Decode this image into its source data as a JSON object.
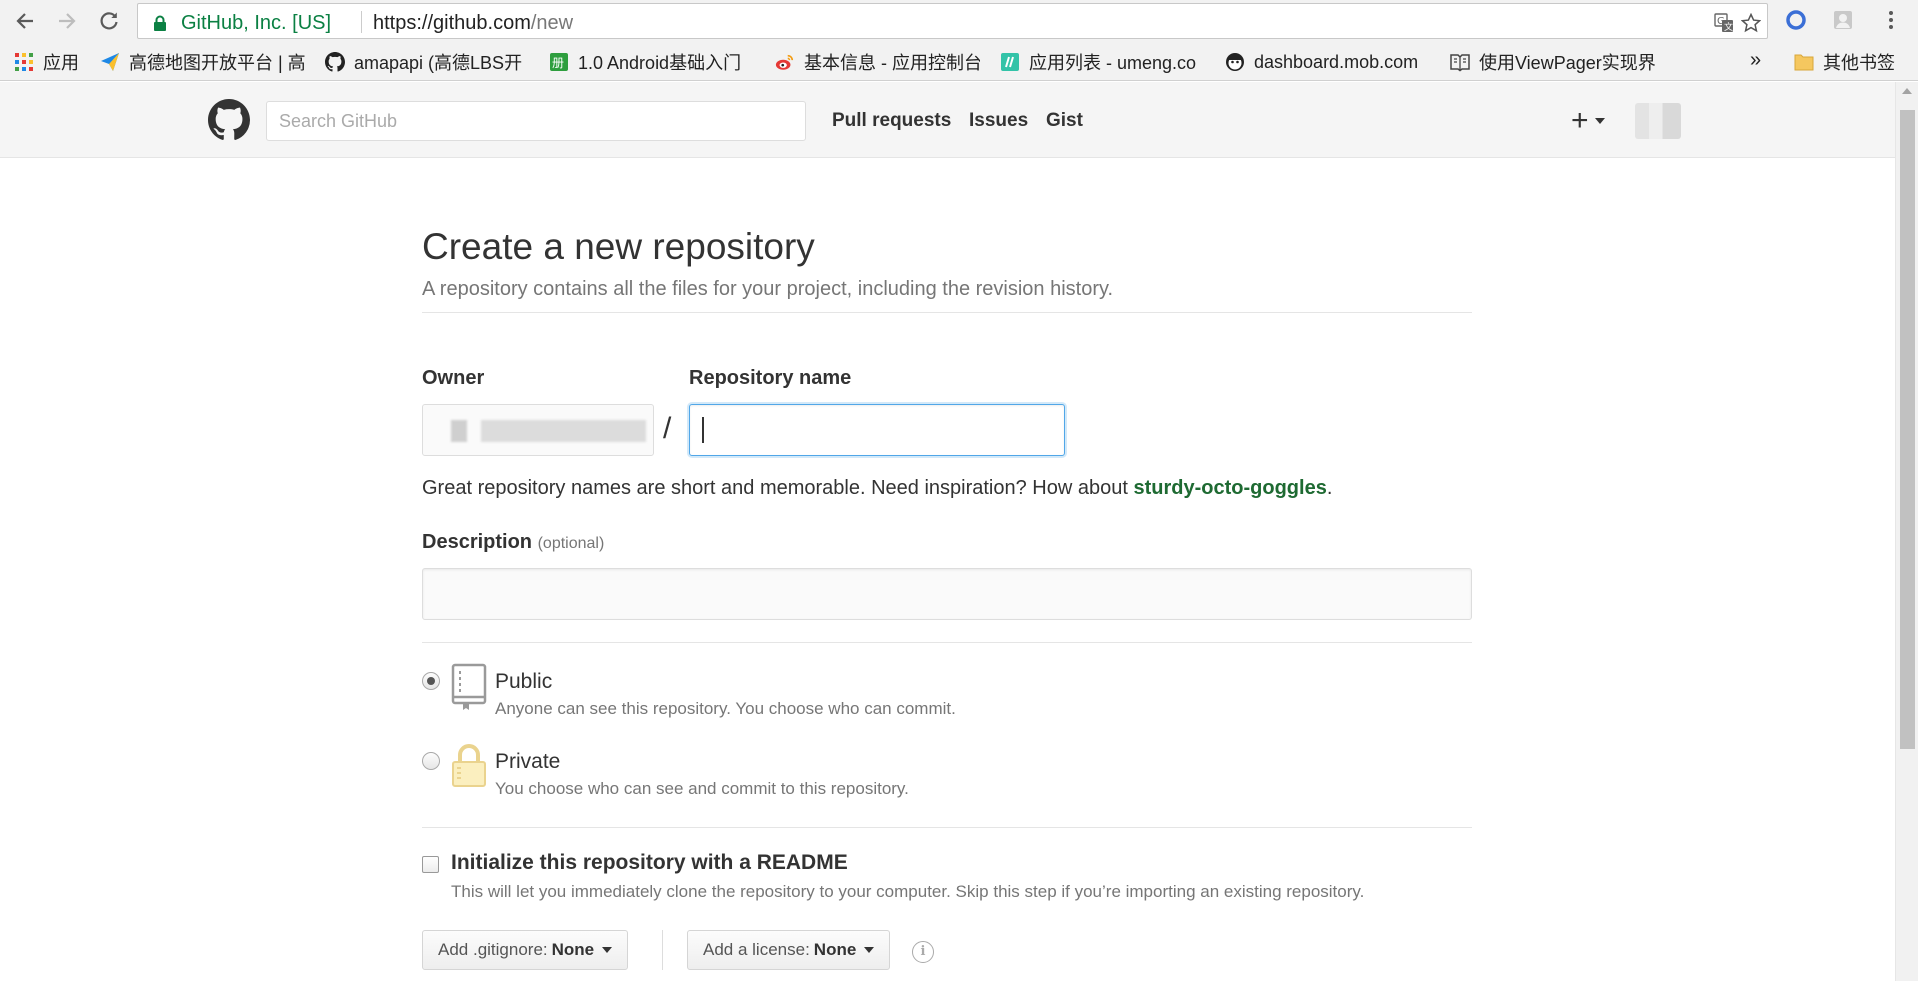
{
  "browser": {
    "omnibox": {
      "ev_label": "GitHub, Inc. [US]",
      "url_origin": "https://github.com",
      "url_path": "/new"
    },
    "bookmarks": [
      {
        "label": "应用",
        "icon": "apps-grid-icon"
      },
      {
        "label": "高德地图开放平台 | 高",
        "icon": "paper-plane-icon"
      },
      {
        "label": "amapapi (高德LBS开",
        "icon": "github-icon"
      },
      {
        "label": "1.0 Android基础入门",
        "icon": "book-green-icon"
      },
      {
        "label": "基本信息 - 应用控制台",
        "icon": "weibo-icon"
      },
      {
        "label": "应用列表 - umeng.co",
        "icon": "umeng-icon"
      },
      {
        "label": "dashboard.mob.com",
        "icon": "mob-icon"
      },
      {
        "label": "使用ViewPager实现界",
        "icon": "book-outline-icon"
      }
    ],
    "overflow_label": "»",
    "other_bookmarks": "其他书签"
  },
  "github": {
    "search_placeholder": "Search GitHub",
    "nav": {
      "pull_requests": "Pull requests",
      "issues": "Issues",
      "gist": "Gist"
    },
    "plus_label": "+"
  },
  "page": {
    "title": "Create a new repository",
    "subtitle": "A repository contains all the files for your project, including the revision history.",
    "owner_label": "Owner",
    "repo_name_label": "Repository name",
    "slash": "/",
    "repo_name_value": "",
    "hint_prefix": "Great repository names are short and memorable. Need inspiration? How about ",
    "hint_suggestion": "sturdy-octo-goggles",
    "hint_suffix": ".",
    "description_label": "Description",
    "description_optional": "(optional)",
    "description_value": "",
    "visibility": {
      "public_title": "Public",
      "public_note": "Anyone can see this repository. You choose who can commit.",
      "public_checked": true,
      "private_title": "Private",
      "private_note": "You choose who can see and commit to this repository.",
      "private_checked": false
    },
    "readme": {
      "title": "Initialize this repository with a README",
      "note": "This will let you immediately clone the repository to your computer. Skip this step if you’re importing an existing repository.",
      "checked": false
    },
    "gitignore": {
      "label": "Add .gitignore:",
      "value": "None"
    },
    "license": {
      "label": "Add a license:",
      "value": "None"
    }
  },
  "colors": {
    "accent_focus": "#51a7e8",
    "suggestion_green": "#1e6a32",
    "secure_green": "#0b8043"
  }
}
